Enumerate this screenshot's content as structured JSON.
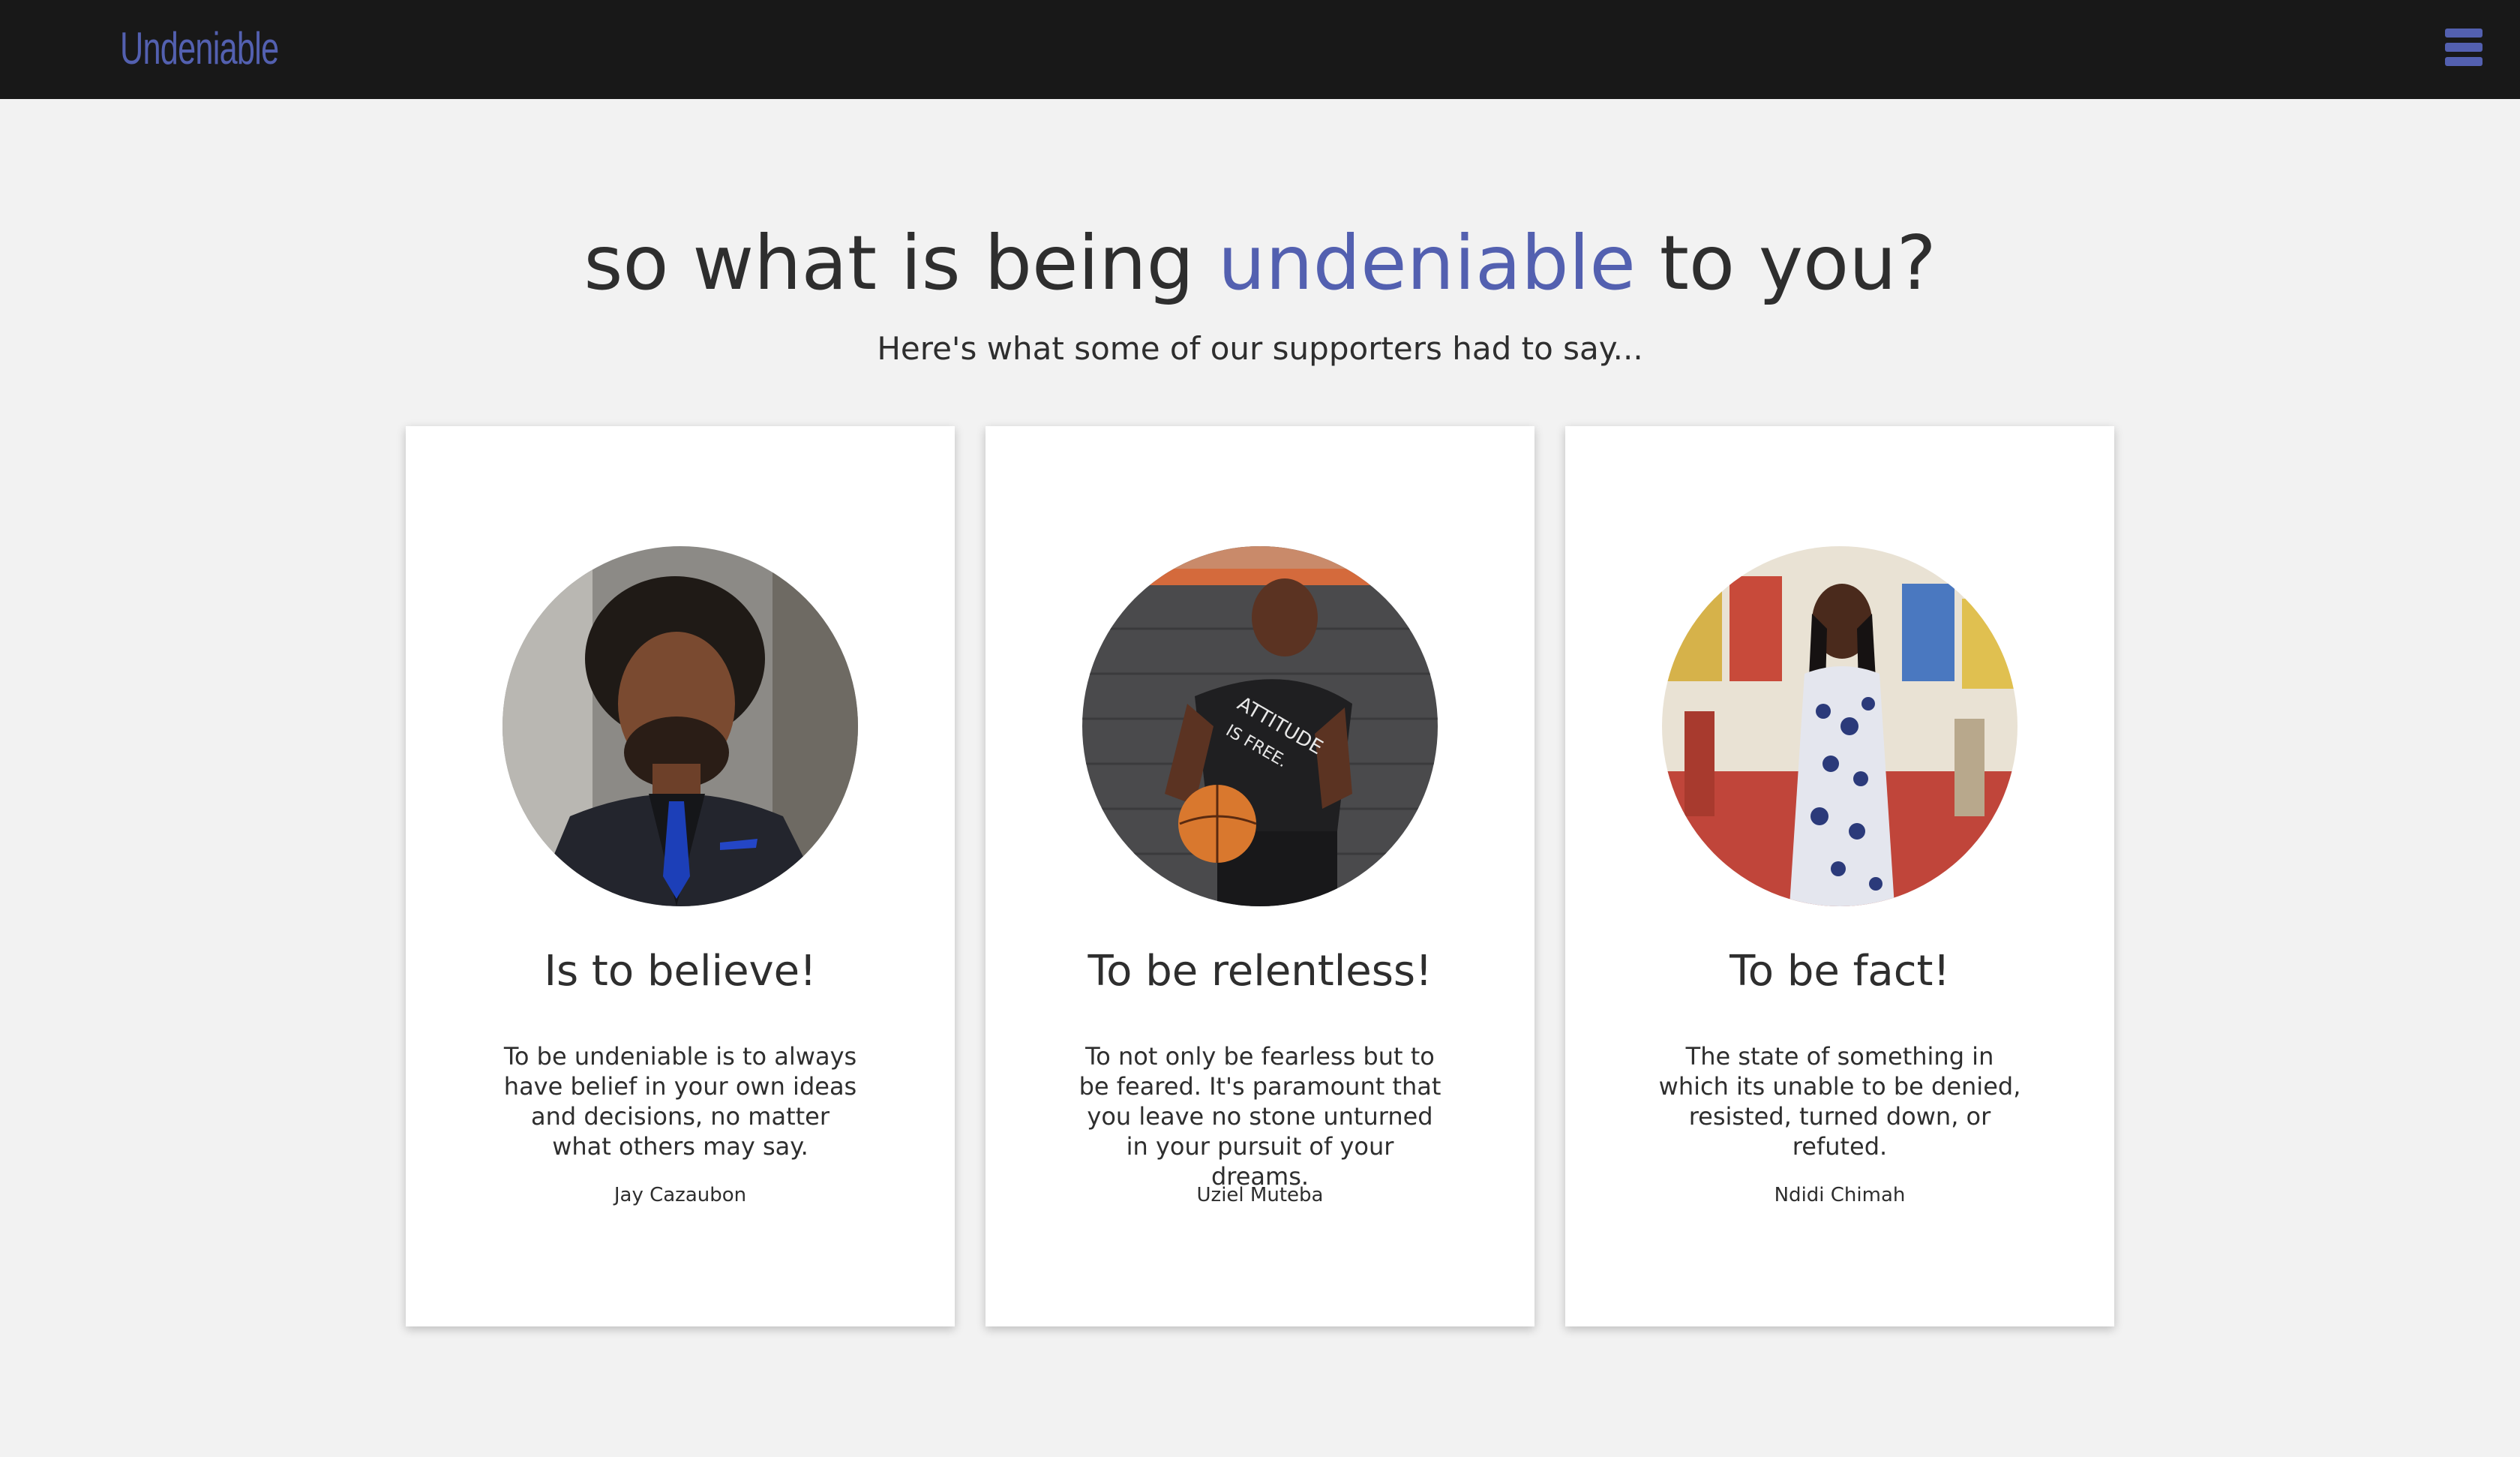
{
  "navbar": {
    "brand": "Undeniable",
    "menu_icon": "hamburger-menu-icon",
    "accent_color": "#5360b0",
    "background_color": "#181818"
  },
  "hero": {
    "heading_before": "so what is being ",
    "heading_accent": "undeniable",
    "heading_after": " to you?",
    "subheading": "Here's what some of our supporters had to say..."
  },
  "testimonials": [
    {
      "title": "Is to believe!",
      "quote": "To be undeniable is to always have belief in your own ideas and decisions, no matter what others may say.",
      "author": "Jay Cazaubon"
    },
    {
      "title": "To be relentless!",
      "quote": "To not only be fearless but to be feared. It's paramount that you leave no stone unturned in your pursuit of your dreams.",
      "author": "Uziel Muteba"
    },
    {
      "title": "To be fact!",
      "quote": "The state of something in which its unable to be denied, resisted, turned down, or refuted.",
      "author": "Ndidi Chimah"
    }
  ]
}
